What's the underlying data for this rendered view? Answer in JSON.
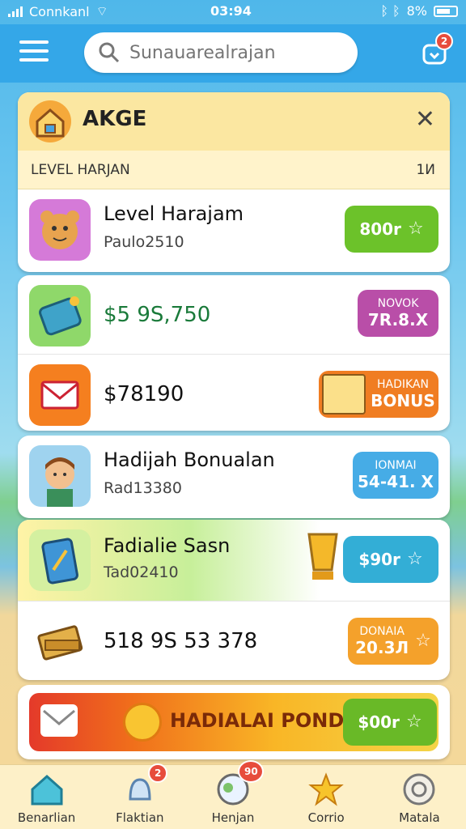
{
  "status_bar": {
    "carrier": "Connkanl",
    "time": "03:94",
    "battery": "8%"
  },
  "header": {
    "search_placeholder": "Sunauarealrajan",
    "notif_badge": "2"
  },
  "panel": {
    "title": "AKGE",
    "subtitle": "LEVEL HARJAN",
    "count": "1И"
  },
  "rows": [
    {
      "title": "Level Harajam",
      "subtitle": "Paulo2510",
      "pill": "800r",
      "pill_color": "#6cc22a"
    },
    {
      "amount": "$5 9S,750",
      "pill_top": "NOVOK",
      "pill": "7R.8.X",
      "pill_color": "#b94ea8"
    },
    {
      "amount": "$78190",
      "pill_top": "HADIKAN",
      "pill": "BONUS",
      "pill_color": "#f07d22"
    },
    {
      "title": "Hadijah Bonualan",
      "subtitle": "Rad13380",
      "pill_top": "IONMAI",
      "pill": "54-41. X",
      "pill_color": "#46ace6"
    },
    {
      "title": "Fadialie Sasn",
      "subtitle": "Tad02410",
      "pill": "$90r",
      "pill_color": "#33aed6"
    },
    {
      "amount": "518 9S 53 378",
      "pill_top": "DONAIA",
      "pill": "20.3Л",
      "pill_color": "#f4a12b"
    }
  ],
  "promo": {
    "label": "HADIALAI PONDS",
    "pill": "$00r",
    "pill_color": "#69b927"
  },
  "nav": [
    {
      "label": "Benarlian"
    },
    {
      "label": "Flaktian",
      "badge": "2"
    },
    {
      "label": "Henjan",
      "badge": "90"
    },
    {
      "label": "Corrio"
    },
    {
      "label": "Matala"
    }
  ],
  "colors": {
    "header_bg": "#34a7e8",
    "panel_header": "#fbe7a1",
    "nav_bg": "#fdf0c8"
  }
}
